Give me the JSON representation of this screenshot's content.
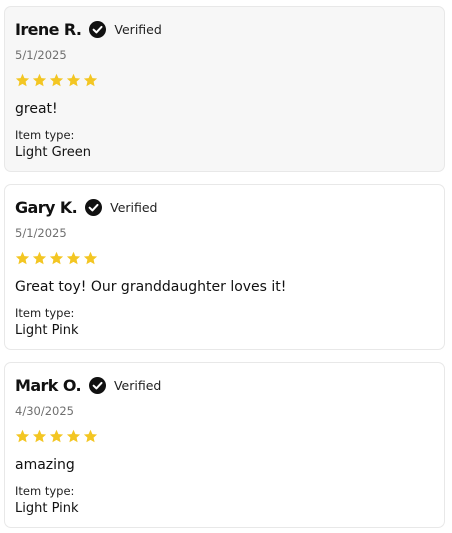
{
  "reviews": [
    {
      "name": "Irene R.",
      "verified_label": "Verified",
      "date": "5/1/2025",
      "rating": 5,
      "body": "great!",
      "item_type_label": "Item type:",
      "item_type_value": "Light Green"
    },
    {
      "name": "Gary K.",
      "verified_label": "Verified",
      "date": "5/1/2025",
      "rating": 5,
      "body": "Great toy! Our granddaughter loves it!",
      "item_type_label": "Item type:",
      "item_type_value": "Light Pink"
    },
    {
      "name": "Mark O.",
      "verified_label": "Verified",
      "date": "4/30/2025",
      "rating": 5,
      "body": "amazing",
      "item_type_label": "Item type:",
      "item_type_value": "Light Pink"
    }
  ],
  "icons": {
    "verified": "check-circle-icon",
    "star": "star-icon"
  },
  "colors": {
    "star": "#f3c623",
    "verified_badge": "#111111",
    "highlight_card_bg": "#f7f7f7",
    "card_border": "#e8e8e8",
    "date_text": "#6f6f6f"
  }
}
